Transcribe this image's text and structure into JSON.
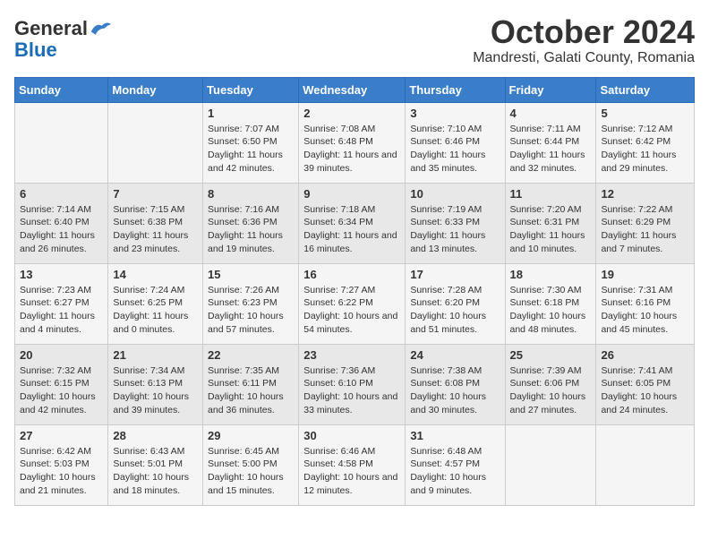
{
  "header": {
    "logo_general": "General",
    "logo_blue": "Blue",
    "month_title": "October 2024",
    "location": "Mandresti, Galati County, Romania"
  },
  "days_of_week": [
    "Sunday",
    "Monday",
    "Tuesday",
    "Wednesday",
    "Thursday",
    "Friday",
    "Saturday"
  ],
  "weeks": [
    [
      {
        "num": "",
        "detail": ""
      },
      {
        "num": "",
        "detail": ""
      },
      {
        "num": "1",
        "detail": "Sunrise: 7:07 AM\nSunset: 6:50 PM\nDaylight: 11 hours and 42 minutes."
      },
      {
        "num": "2",
        "detail": "Sunrise: 7:08 AM\nSunset: 6:48 PM\nDaylight: 11 hours and 39 minutes."
      },
      {
        "num": "3",
        "detail": "Sunrise: 7:10 AM\nSunset: 6:46 PM\nDaylight: 11 hours and 35 minutes."
      },
      {
        "num": "4",
        "detail": "Sunrise: 7:11 AM\nSunset: 6:44 PM\nDaylight: 11 hours and 32 minutes."
      },
      {
        "num": "5",
        "detail": "Sunrise: 7:12 AM\nSunset: 6:42 PM\nDaylight: 11 hours and 29 minutes."
      }
    ],
    [
      {
        "num": "6",
        "detail": "Sunrise: 7:14 AM\nSunset: 6:40 PM\nDaylight: 11 hours and 26 minutes."
      },
      {
        "num": "7",
        "detail": "Sunrise: 7:15 AM\nSunset: 6:38 PM\nDaylight: 11 hours and 23 minutes."
      },
      {
        "num": "8",
        "detail": "Sunrise: 7:16 AM\nSunset: 6:36 PM\nDaylight: 11 hours and 19 minutes."
      },
      {
        "num": "9",
        "detail": "Sunrise: 7:18 AM\nSunset: 6:34 PM\nDaylight: 11 hours and 16 minutes."
      },
      {
        "num": "10",
        "detail": "Sunrise: 7:19 AM\nSunset: 6:33 PM\nDaylight: 11 hours and 13 minutes."
      },
      {
        "num": "11",
        "detail": "Sunrise: 7:20 AM\nSunset: 6:31 PM\nDaylight: 11 hours and 10 minutes."
      },
      {
        "num": "12",
        "detail": "Sunrise: 7:22 AM\nSunset: 6:29 PM\nDaylight: 11 hours and 7 minutes."
      }
    ],
    [
      {
        "num": "13",
        "detail": "Sunrise: 7:23 AM\nSunset: 6:27 PM\nDaylight: 11 hours and 4 minutes."
      },
      {
        "num": "14",
        "detail": "Sunrise: 7:24 AM\nSunset: 6:25 PM\nDaylight: 11 hours and 0 minutes."
      },
      {
        "num": "15",
        "detail": "Sunrise: 7:26 AM\nSunset: 6:23 PM\nDaylight: 10 hours and 57 minutes."
      },
      {
        "num": "16",
        "detail": "Sunrise: 7:27 AM\nSunset: 6:22 PM\nDaylight: 10 hours and 54 minutes."
      },
      {
        "num": "17",
        "detail": "Sunrise: 7:28 AM\nSunset: 6:20 PM\nDaylight: 10 hours and 51 minutes."
      },
      {
        "num": "18",
        "detail": "Sunrise: 7:30 AM\nSunset: 6:18 PM\nDaylight: 10 hours and 48 minutes."
      },
      {
        "num": "19",
        "detail": "Sunrise: 7:31 AM\nSunset: 6:16 PM\nDaylight: 10 hours and 45 minutes."
      }
    ],
    [
      {
        "num": "20",
        "detail": "Sunrise: 7:32 AM\nSunset: 6:15 PM\nDaylight: 10 hours and 42 minutes."
      },
      {
        "num": "21",
        "detail": "Sunrise: 7:34 AM\nSunset: 6:13 PM\nDaylight: 10 hours and 39 minutes."
      },
      {
        "num": "22",
        "detail": "Sunrise: 7:35 AM\nSunset: 6:11 PM\nDaylight: 10 hours and 36 minutes."
      },
      {
        "num": "23",
        "detail": "Sunrise: 7:36 AM\nSunset: 6:10 PM\nDaylight: 10 hours and 33 minutes."
      },
      {
        "num": "24",
        "detail": "Sunrise: 7:38 AM\nSunset: 6:08 PM\nDaylight: 10 hours and 30 minutes."
      },
      {
        "num": "25",
        "detail": "Sunrise: 7:39 AM\nSunset: 6:06 PM\nDaylight: 10 hours and 27 minutes."
      },
      {
        "num": "26",
        "detail": "Sunrise: 7:41 AM\nSunset: 6:05 PM\nDaylight: 10 hours and 24 minutes."
      }
    ],
    [
      {
        "num": "27",
        "detail": "Sunrise: 6:42 AM\nSunset: 5:03 PM\nDaylight: 10 hours and 21 minutes."
      },
      {
        "num": "28",
        "detail": "Sunrise: 6:43 AM\nSunset: 5:01 PM\nDaylight: 10 hours and 18 minutes."
      },
      {
        "num": "29",
        "detail": "Sunrise: 6:45 AM\nSunset: 5:00 PM\nDaylight: 10 hours and 15 minutes."
      },
      {
        "num": "30",
        "detail": "Sunrise: 6:46 AM\nSunset: 4:58 PM\nDaylight: 10 hours and 12 minutes."
      },
      {
        "num": "31",
        "detail": "Sunrise: 6:48 AM\nSunset: 4:57 PM\nDaylight: 10 hours and 9 minutes."
      },
      {
        "num": "",
        "detail": ""
      },
      {
        "num": "",
        "detail": ""
      }
    ]
  ]
}
